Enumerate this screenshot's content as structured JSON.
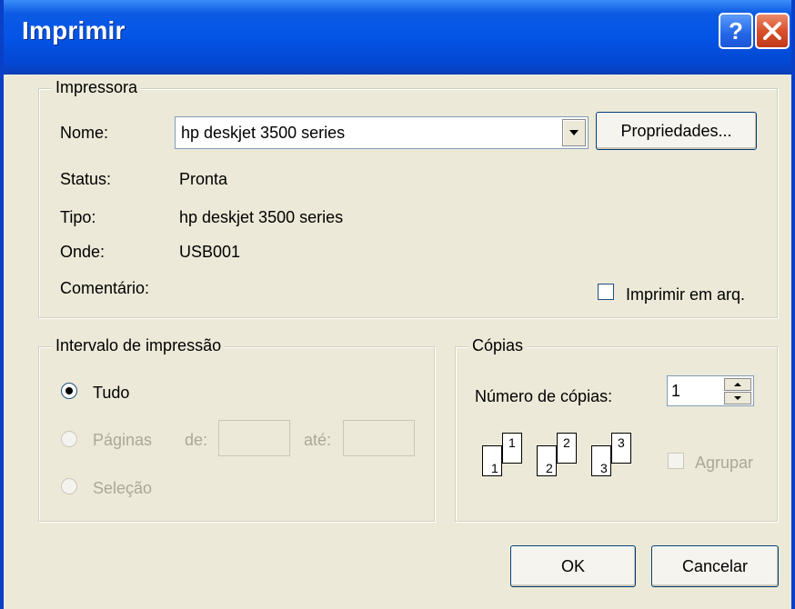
{
  "window": {
    "title": "Imprimir",
    "help_glyph": "?",
    "close_glyph": "×"
  },
  "printer_group": {
    "title": "Impressora",
    "name_label": "Nome:",
    "name_value": "hp deskjet 3500 series",
    "properties_button": "Propriedades...",
    "status_label": "Status:",
    "status_value": "Pronta",
    "type_label": "Tipo:",
    "type_value": "hp deskjet 3500 series",
    "where_label": "Onde:",
    "where_value": "USB001",
    "comment_label": "Comentário:",
    "print_to_file_label": "Imprimir em arq.",
    "print_to_file_checked": false
  },
  "range_group": {
    "title": "Intervalo de impressão",
    "all_label": "Tudo",
    "pages_label": "Páginas",
    "from_label": "de:",
    "to_label": "até:",
    "from_value": "",
    "to_value": "",
    "selection_label": "Seleção",
    "selected": "all"
  },
  "copies_group": {
    "title": "Cópias",
    "count_label": "Número de cópias:",
    "count_value": "1",
    "collate_label": "Agrupar",
    "collate_checked": false,
    "collate_pages": [
      "1",
      "1",
      "2",
      "2",
      "3",
      "3"
    ]
  },
  "footer": {
    "ok_button": "OK",
    "cancel_button": "Cancelar"
  },
  "icons": [
    "help-icon",
    "close-icon",
    "dropdown-arrow-icon",
    "spin-up-icon",
    "spin-down-icon",
    "collate-icon"
  ],
  "colors": {
    "titlebar": "#0454e6",
    "face": "#ece9d8",
    "close": "#d9502a",
    "disabled_text": "#aca899"
  }
}
